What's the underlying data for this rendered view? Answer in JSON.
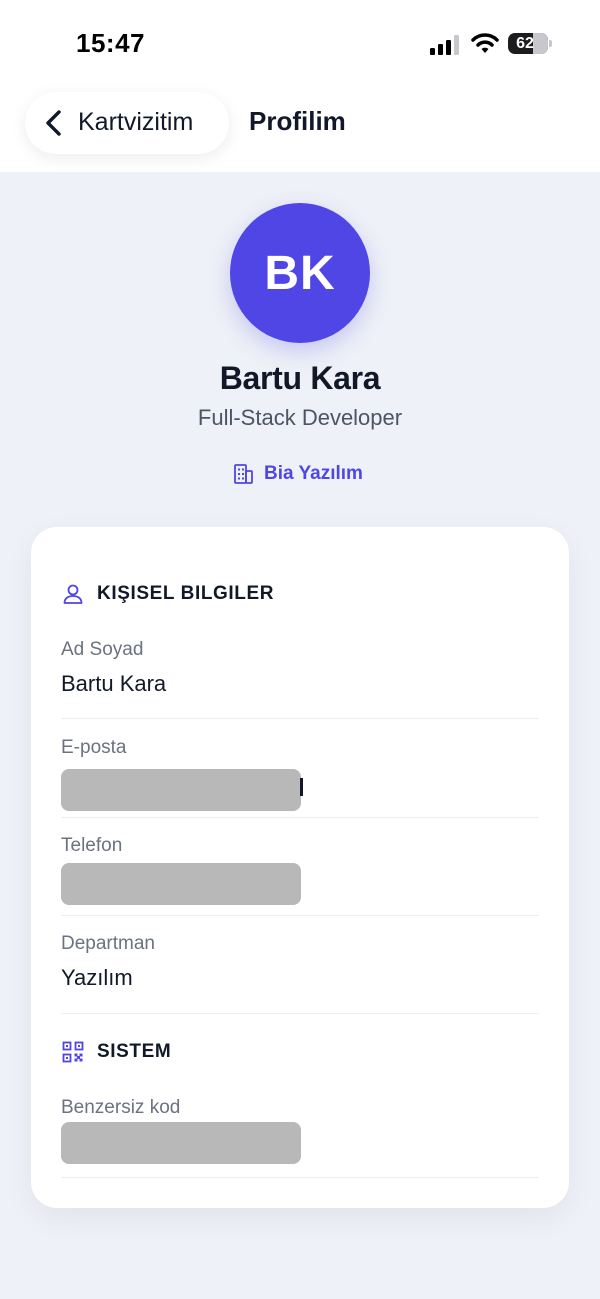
{
  "status_bar": {
    "time": "15:47",
    "battery": "62",
    "battery_level": 0.62,
    "icons": [
      "signal-icon",
      "wifi-icon",
      "battery-icon"
    ]
  },
  "nav": {
    "back_label": "Kartvizitim",
    "title": "Profilim",
    "back_icon": "chevron-left-icon"
  },
  "profile": {
    "initials": "BK",
    "name": "Bartu Kara",
    "title": "Full-Stack Developer",
    "company": "Bia Yazılım",
    "company_icon": "building-icon"
  },
  "colors": {
    "accent": "#4f46e5",
    "background": "#eef1f7",
    "card": "#ffffff",
    "redaction": "#b8b8b8"
  },
  "personal": {
    "header": "KIŞISEL BILGILER",
    "icon": "user-icon",
    "fields": [
      {
        "label": "Ad Soyad",
        "value": "Bartu Kara"
      },
      {
        "label": "E-posta",
        "value": ""
      },
      {
        "label": "Telefon",
        "value": ""
      },
      {
        "label": "Departman",
        "value": "Yazılım"
      }
    ]
  },
  "system": {
    "header": "SISTEM",
    "icon": "qr-code-icon",
    "fields": [
      {
        "label": "Benzersiz kod",
        "value": ""
      }
    ]
  }
}
